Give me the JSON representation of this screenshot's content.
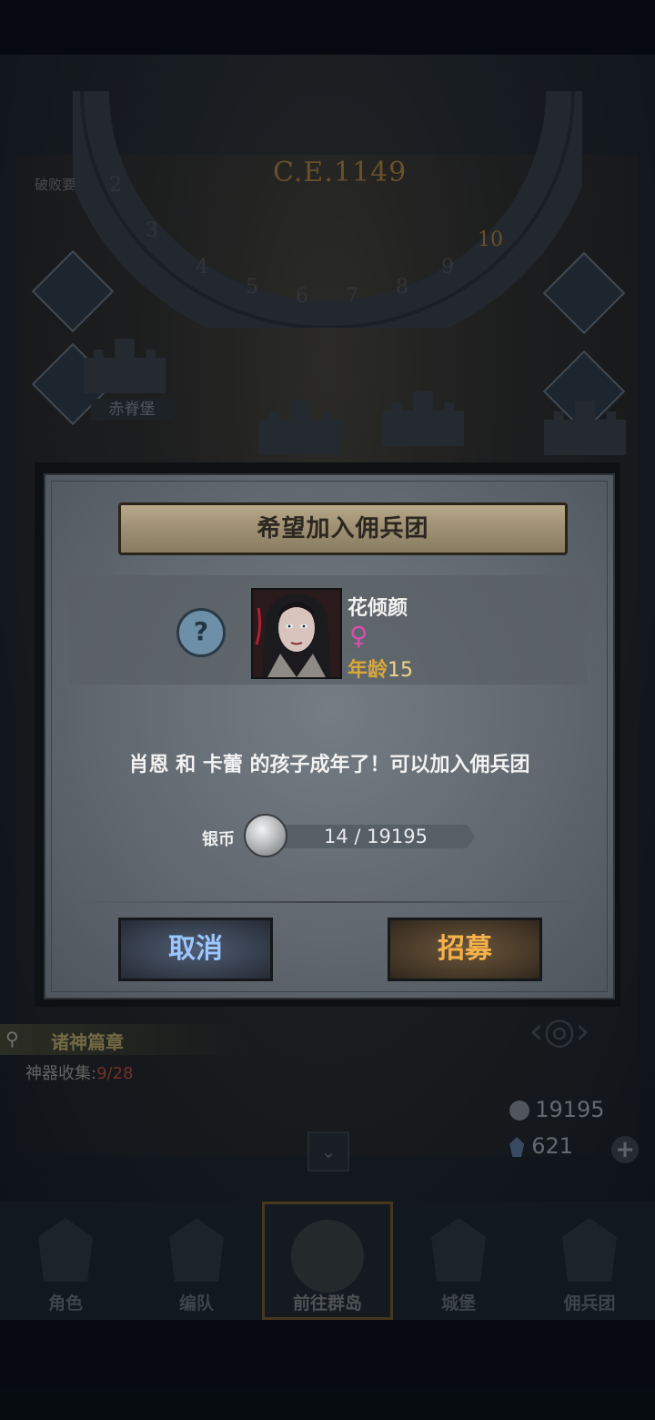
{
  "map": {
    "era": "C.E.1149",
    "top_label": "破败要",
    "location_label": "赤脊堡"
  },
  "codex": {
    "title": "诸神篇章",
    "collection_label": "神器收集:",
    "collection_count": "9/28"
  },
  "resources": {
    "silver": "19195",
    "gems": "621"
  },
  "bottom_nav": {
    "items": [
      {
        "label": "角色"
      },
      {
        "label": "编队"
      },
      {
        "label": "前往群岛"
      },
      {
        "label": "城堡"
      },
      {
        "label": "佣兵团"
      }
    ]
  },
  "modal": {
    "title": "希望加入佣兵团",
    "character": {
      "name": "花倾颜",
      "gender_symbol": "♀",
      "age_label": "年龄",
      "age_value": "15"
    },
    "unknown_symbol": "?",
    "message": "肖恩 和 卡蕾 的孩子成年了！可以加入佣兵团",
    "cost": {
      "label": "银币",
      "value": "14 / 19195"
    },
    "cancel_label": "取消",
    "recruit_label": "招募"
  },
  "colors": {
    "recruit_text": "#f6b24a",
    "cancel_text": "#9cc6ff",
    "age_label": "#d8a63c",
    "gender": "#d64fb0"
  }
}
